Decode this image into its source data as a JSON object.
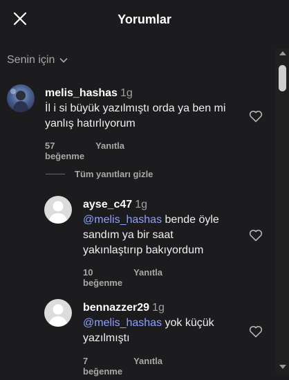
{
  "header": {
    "title": "Yorumlar"
  },
  "filter": {
    "label": "Senin için"
  },
  "comments": [
    {
      "username": "melis_hashas",
      "time": "1g",
      "text": "İl i si büyük yazılmıştı orda ya ben mi yanlış hatırlıyorum",
      "line1": "İl i si büyük yazılmıştı orda ya ben mi",
      "line2": "yanlış hatırlıyorum",
      "likes": "57 beğenme",
      "reply": "Yanıtla"
    }
  ],
  "hide_replies": "Tüm yanıtları gizle",
  "replies": [
    {
      "username": "ayse_c47",
      "time": "1g",
      "mention": "@melis_hashas",
      "line1_rest": " bende öyle",
      "line2": "sandım ya bir saat",
      "line3": "yakınlaştırıp bakıyordum",
      "likes": "10 beğenme",
      "reply": "Yanıtla"
    },
    {
      "username": "bennazzer29",
      "time": "1g",
      "mention": "@melis_hashas",
      "line1_rest": " yok küçük",
      "line2": "yazılmıştı",
      "likes": "7 beğenme",
      "reply": "Yanıtla"
    }
  ],
  "icons": [
    "close-icon",
    "chevron-down-icon",
    "heart-icon",
    "avatar"
  ]
}
